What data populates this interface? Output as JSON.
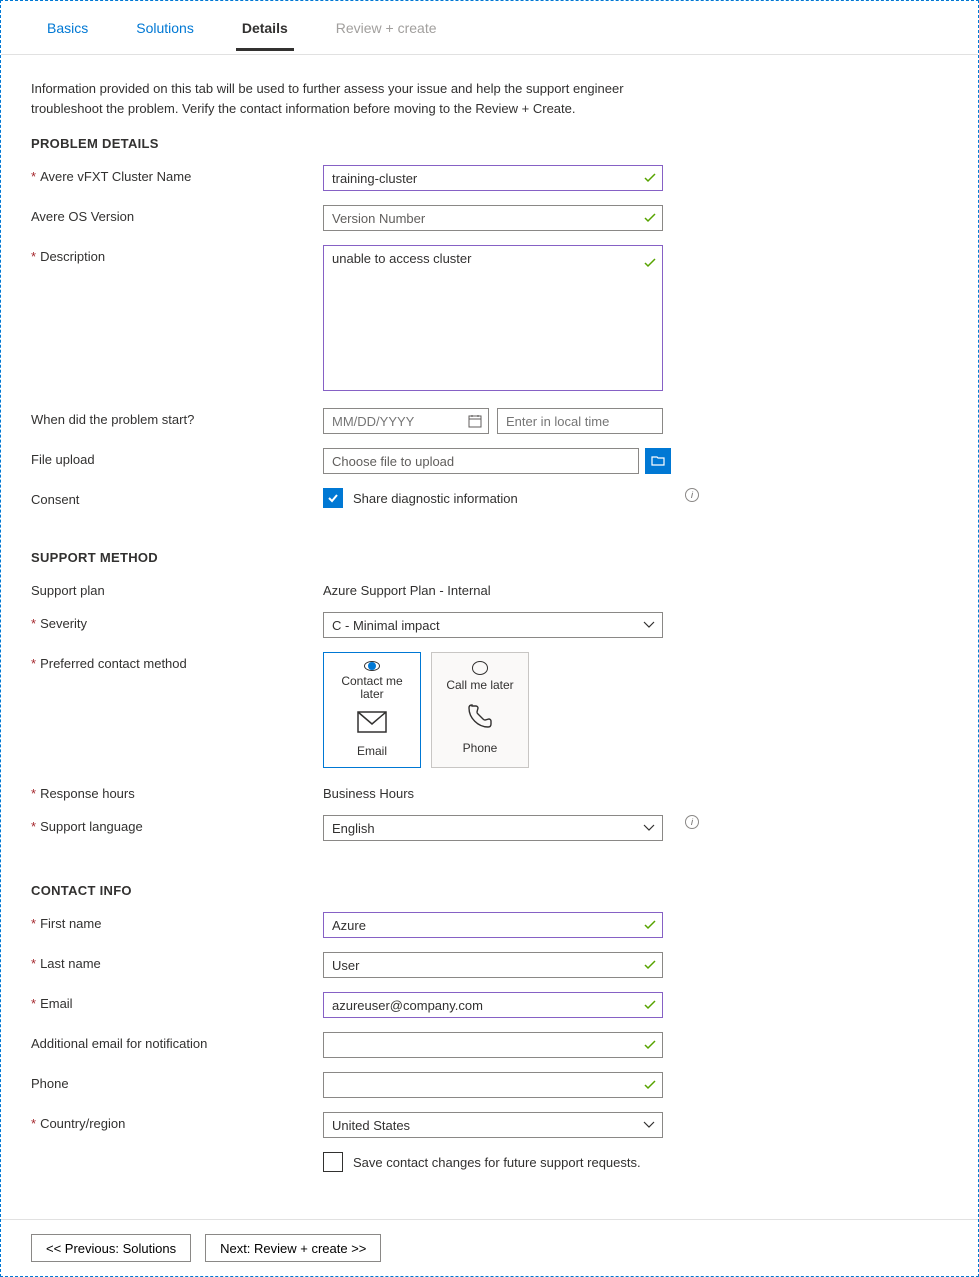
{
  "tabs": {
    "basics": "Basics",
    "solutions": "Solutions",
    "details": "Details",
    "review": "Review + create"
  },
  "intro": "Information provided on this tab will be used to further assess your issue and help the support engineer troubleshoot the problem. Verify the contact information before moving to the Review + Create.",
  "sections": {
    "problem": "PROBLEM DETAILS",
    "support": "SUPPORT METHOD",
    "contact": "CONTACT INFO"
  },
  "labels": {
    "cluster": "Avere vFXT Cluster Name",
    "os": "Avere OS Version",
    "desc": "Description",
    "when": "When did the problem start?",
    "upload": "File upload",
    "consent": "Consent",
    "plan": "Support plan",
    "severity": "Severity",
    "pref": "Preferred contact method",
    "resp": "Response hours",
    "lang": "Support language",
    "fname": "First name",
    "lname": "Last name",
    "email": "Email",
    "addemail": "Additional email for notification",
    "phone": "Phone",
    "country": "Country/region"
  },
  "values": {
    "cluster": "training-cluster",
    "os_placeholder": "Version Number",
    "desc": "unable to access cluster",
    "date_placeholder": "MM/DD/YYYY",
    "time_placeholder": "Enter in local time",
    "file_placeholder": "Choose file to upload",
    "consent_label": "Share diagnostic information",
    "plan": "Azure Support Plan - Internal",
    "severity": "C - Minimal impact",
    "card_email_top": "Contact me later",
    "card_email_bottom": "Email",
    "card_phone_top": "Call me later",
    "card_phone_bottom": "Phone",
    "resp": "Business Hours",
    "lang": "English",
    "fname": "Azure",
    "lname": "User",
    "email": "azureuser@company.com",
    "addemail": "",
    "phonev": "",
    "country": "United States",
    "save_contact": "Save contact changes for future support requests."
  },
  "footer": {
    "prev": "<< Previous: Solutions",
    "next": "Next: Review + create >>"
  }
}
